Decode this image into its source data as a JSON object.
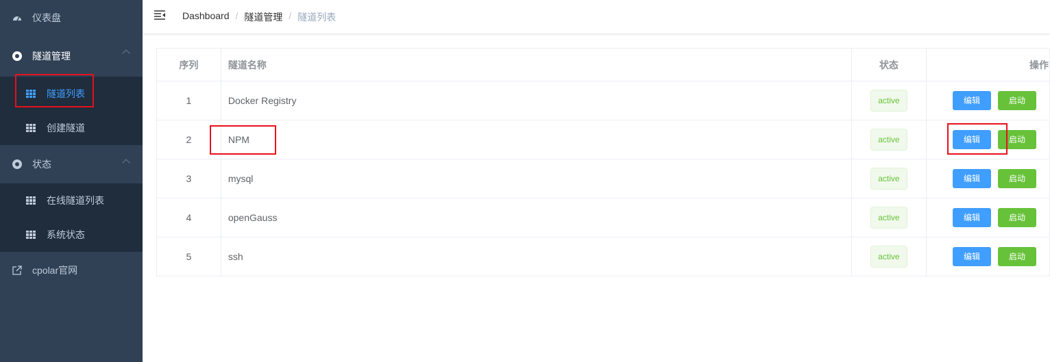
{
  "sidebar": {
    "dashboard": "仪表盘",
    "tunnel_mgmt": "隧道管理",
    "tunnel_list": "隧道列表",
    "create_tunnel": "创建隧道",
    "status": "状态",
    "online_list": "在线隧道列表",
    "system_status": "系统状态",
    "cpolar_site": "cpolar官网"
  },
  "breadcrumb": [
    "Dashboard",
    "隧道管理",
    "隧道列表"
  ],
  "table": {
    "headers": [
      "序列",
      "隧道名称",
      "状态",
      "操作"
    ],
    "rows": [
      {
        "id": "1",
        "name": "Docker Registry",
        "status": "active"
      },
      {
        "id": "2",
        "name": "NPM",
        "status": "active"
      },
      {
        "id": "3",
        "name": "mysql",
        "status": "active"
      },
      {
        "id": "4",
        "name": "openGauss",
        "status": "active"
      },
      {
        "id": "5",
        "name": "ssh",
        "status": "active"
      }
    ],
    "edit_label": "编辑",
    "start_label": "启动"
  },
  "colors": {
    "sidebar_bg": "#304156",
    "active": "#409eff",
    "success": "#67c23a",
    "highlight": "#e8101a"
  }
}
